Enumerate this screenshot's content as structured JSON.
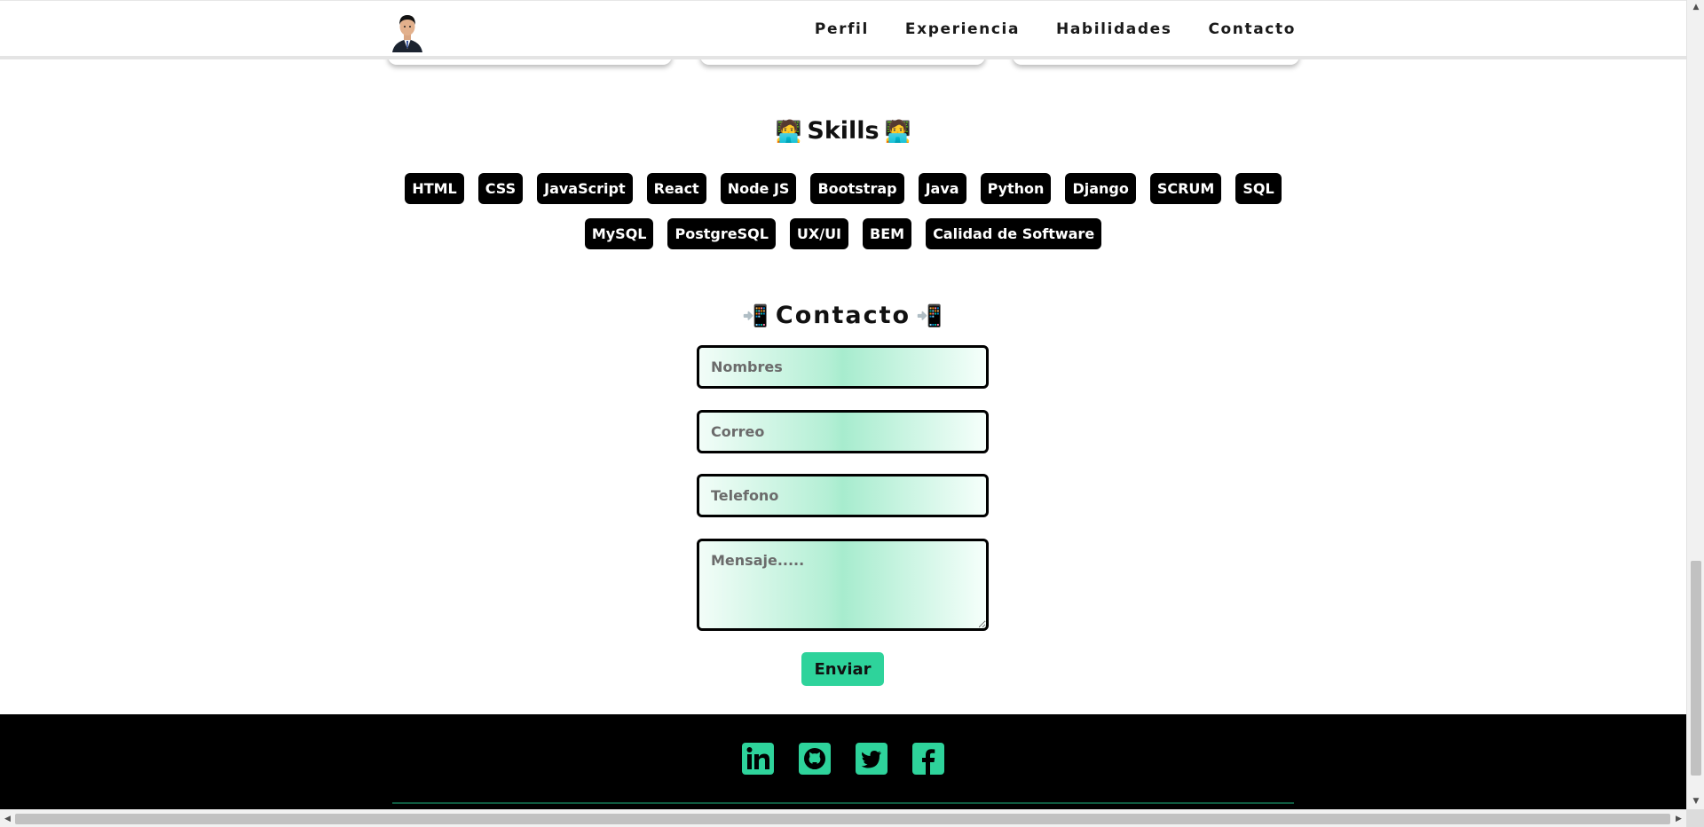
{
  "nav": {
    "avatar_alt": "avatar",
    "links": [
      "Perfil",
      "Experiencia",
      "Habilidades",
      "Contacto"
    ]
  },
  "skills": {
    "title": "Skills",
    "emoji": "🧑‍💻",
    "items": [
      "HTML",
      "CSS",
      "JavaScript",
      "React",
      "Node JS",
      "Bootstrap",
      "Java",
      "Python",
      "Django",
      "SCRUM",
      "SQL",
      "MySQL",
      "PostgreSQL",
      "UX/UI",
      "BEM",
      "Calidad de Software"
    ]
  },
  "contact": {
    "title": "Contacto",
    "emoji": "📲",
    "name_placeholder": "Nombres",
    "email_placeholder": "Correo",
    "phone_placeholder": "Telefono",
    "message_placeholder": "Mensaje.....",
    "send_label": "Enviar"
  },
  "footer": {
    "social_icons": [
      "linkedin-icon",
      "github-icon",
      "twitter-icon",
      "facebook-icon"
    ],
    "icon_color": "#2ed39b"
  },
  "colors": {
    "accent": "#2ed39b",
    "chip_bg": "#000000",
    "footer_bg": "#000000"
  }
}
